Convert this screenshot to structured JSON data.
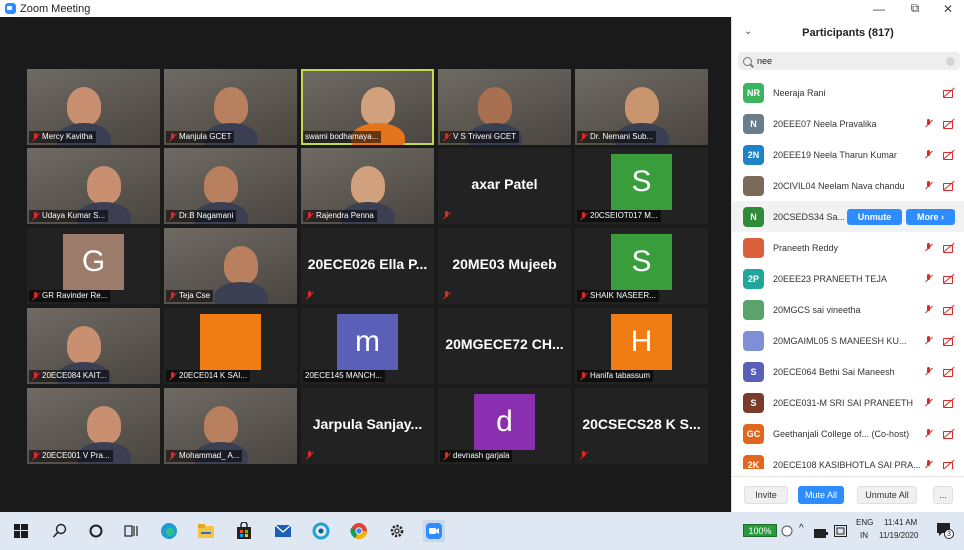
{
  "window": {
    "title": "Zoom Meeting",
    "minimize_glyph": "—",
    "restore_glyph": "⧉",
    "close_glyph": "✕"
  },
  "tiles": [
    {
      "kind": "video",
      "label": "Mercy Kavitha",
      "muted": true
    },
    {
      "kind": "video",
      "label": "Manjula GCET",
      "muted": true
    },
    {
      "kind": "video",
      "label": "swami bodhamaya...",
      "muted": false,
      "active": true
    },
    {
      "kind": "video",
      "label": "V S Triveni GCET",
      "muted": true
    },
    {
      "kind": "video",
      "label": "Dr. Nemani Sub...",
      "muted": true
    },
    {
      "kind": "video",
      "label": "Udaya Kumar S...",
      "muted": true
    },
    {
      "kind": "video",
      "label": "Dr.B Nagamani",
      "muted": true
    },
    {
      "kind": "video",
      "label": "Rajendra Penna",
      "muted": true
    },
    {
      "kind": "name",
      "bigname": "axar Patel",
      "muted": true
    },
    {
      "kind": "avatar",
      "letter": "S",
      "color": "#3a9d3c",
      "label": "20CSEIOT017 M...",
      "muted": true
    },
    {
      "kind": "avatar",
      "letter": "G",
      "color": "#9c7b6a",
      "label": "GR Ravinder Re...",
      "muted": true
    },
    {
      "kind": "video",
      "label": "Teja Cse",
      "muted": true
    },
    {
      "kind": "name",
      "bigname": "20ECE026 Ella P...",
      "muted": true
    },
    {
      "kind": "name",
      "bigname": "20ME03 Mujeeb",
      "muted": true
    },
    {
      "kind": "avatar",
      "letter": "S",
      "color": "#3a9d3c",
      "label": "SHAIK NASEER...",
      "muted": true
    },
    {
      "kind": "video",
      "label": "20ECE084 KAIT...",
      "muted": true
    },
    {
      "kind": "avatar",
      "letter": "",
      "color": "#ef7d14",
      "label": "20ECE014 K SAI...",
      "muted": true
    },
    {
      "kind": "avatar",
      "letter": "m",
      "color": "#5a5fb8",
      "label": "20ECE145 MANCH...",
      "muted": false
    },
    {
      "kind": "name",
      "bigname": "20MGECE72 CH...",
      "muted": false
    },
    {
      "kind": "avatar",
      "letter": "H",
      "color": "#ef7d14",
      "label": "Hanifa tabassum",
      "muted": true
    },
    {
      "kind": "video",
      "label": "20ECE001 V Pra...",
      "muted": true
    },
    {
      "kind": "video",
      "label": "Mohammad_ A...",
      "muted": true
    },
    {
      "kind": "name",
      "bigname": "Jarpula Sanjay...",
      "muted": true
    },
    {
      "kind": "avatar",
      "letter": "d",
      "color": "#8a2fb0",
      "label": "devnash garjala",
      "muted": true
    },
    {
      "kind": "name",
      "bigname": "20CSECS28 K S...",
      "muted": true
    }
  ],
  "participants_panel": {
    "title": "Participants (817)",
    "collapse_glyph": "⌄",
    "search_value": "nee",
    "rows": [
      {
        "initials": "NR",
        "color": "#3bb55c",
        "name": "Neeraja Rani",
        "mic_muted": false,
        "cam_off": true
      },
      {
        "initials": "N",
        "color": "#6b7d8a",
        "name": "20EEE07 Neela Pravalika",
        "mic_muted": true,
        "cam_off": true
      },
      {
        "initials": "2N",
        "color": "#1f84c6",
        "name": "20EEE19 Neela Tharun Kumar",
        "mic_muted": true,
        "cam_off": true
      },
      {
        "initials": "",
        "color": "#7b6a5a",
        "name": "20CIVIL04 Neelam Nava chandu",
        "mic_muted": true,
        "cam_off": true
      },
      {
        "initials": "N",
        "color": "#2e8b3a",
        "name": "20CSEDS34 Sa...",
        "mic_muted": false,
        "cam_off": false,
        "hover": true,
        "unmute_label": "Unmute",
        "more_label": "More ›"
      },
      {
        "initials": "",
        "color": "#d9603a",
        "name": "Praneeth Reddy",
        "mic_muted": true,
        "cam_off": true
      },
      {
        "initials": "2P",
        "color": "#20a79a",
        "name": "20EEE23 PRANEETH TEJA",
        "mic_muted": true,
        "cam_off": true
      },
      {
        "initials": "",
        "color": "#5aa36c",
        "name": "20MGCS sai vineetha",
        "mic_muted": true,
        "cam_off": true
      },
      {
        "initials": "",
        "color": "#7f8fd6",
        "name": "20MGAIML05 S MANEESH KU...",
        "mic_muted": true,
        "cam_off": true
      },
      {
        "initials": "S",
        "color": "#5a5fb8",
        "name": "20ECE064 Bethi Sai Maneesh",
        "mic_muted": true,
        "cam_off": true
      },
      {
        "initials": "S",
        "color": "#7a3b2a",
        "name": "20ECE031-M SRI SAI PRANEETH",
        "mic_muted": true,
        "cam_off": true
      },
      {
        "initials": "GC",
        "color": "#e2661b",
        "name": "Geethanjali College of... (Co-host)",
        "mic_muted": true,
        "cam_off": true
      },
      {
        "initials": "2K",
        "color": "#e2661b",
        "name": "20ECE108 KASIBHOTLA SAI PRA...",
        "mic_muted": true,
        "cam_off": true
      }
    ],
    "footer": {
      "invite": "Invite",
      "mute_all": "Mute All",
      "unmute_all": "Unmute All",
      "more": "..."
    }
  },
  "taskbar": {
    "zoom_level": "100%",
    "language_top": "ENG",
    "language_bottom": "IN",
    "time": "11:41 AM",
    "date": "11/19/2020",
    "notification_count": "3"
  }
}
